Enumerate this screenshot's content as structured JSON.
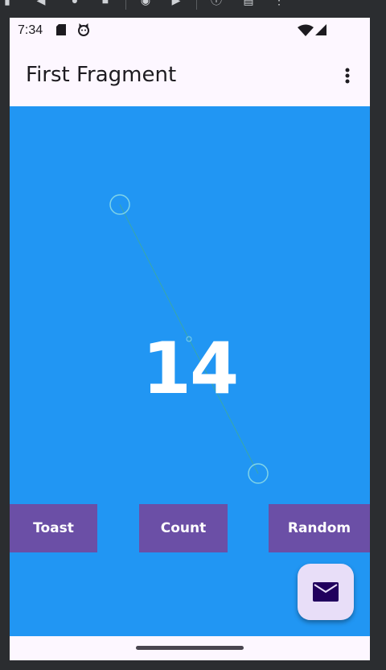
{
  "status_bar": {
    "time": "7:34",
    "icons": [
      "sd-card-icon",
      "cat-icon",
      "wifi-icon",
      "signal-icon"
    ]
  },
  "app_bar": {
    "title": "First Fragment",
    "overflow_icon": "more-vert-icon"
  },
  "main": {
    "count": "14",
    "background_color": "#2196f3"
  },
  "buttons": {
    "toast_label": "Toast",
    "count_label": "Count",
    "random_label": "Random",
    "color": "#6b4fa6"
  },
  "fab": {
    "icon": "email-icon",
    "color": "#e8def8"
  }
}
